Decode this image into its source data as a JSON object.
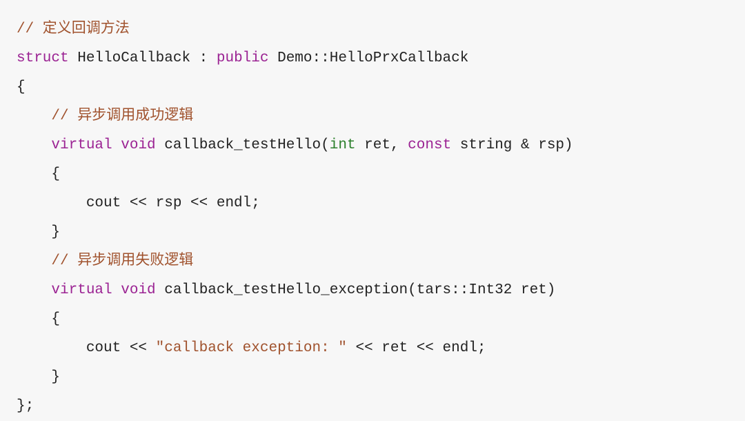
{
  "code": {
    "l01": {
      "comment": "// 定义回调方法"
    },
    "l02": {
      "kw1": "struct",
      "name": " HelloCallback ",
      "colon": ": ",
      "kw2": "public",
      "rest": " Demo::HelloPrxCallback"
    },
    "l03": {
      "text": "{"
    },
    "l04": {
      "indent": "    ",
      "comment": "// 异步调用成功逻辑"
    },
    "l05": {
      "indent": "    ",
      "kw1": "virtual",
      "sp1": " ",
      "kw2": "void",
      "sp2": " ",
      "fn": "callback_testHello(",
      "type1": "int",
      "arg1": " ret, ",
      "kw3": "const",
      "sp3": " ",
      "arg2": "string & rsp)"
    },
    "l06": {
      "text": "    {"
    },
    "l07": {
      "text": "        cout << rsp << endl;"
    },
    "l08": {
      "text": "    }"
    },
    "l09": {
      "indent": "    ",
      "comment": "// 异步调用失败逻辑"
    },
    "l10": {
      "indent": "    ",
      "kw1": "virtual",
      "sp1": " ",
      "kw2": "void",
      "sp2": " ",
      "fn": "callback_testHello_exception(tars::Int32 ret)"
    },
    "l11": {
      "text": "    {"
    },
    "l12": {
      "text": "        cout << ",
      "str": "\"callback exception: \"",
      "rest": " << ret << endl;"
    },
    "l13": {
      "text": "    }"
    },
    "l14": {
      "text": "};"
    }
  }
}
